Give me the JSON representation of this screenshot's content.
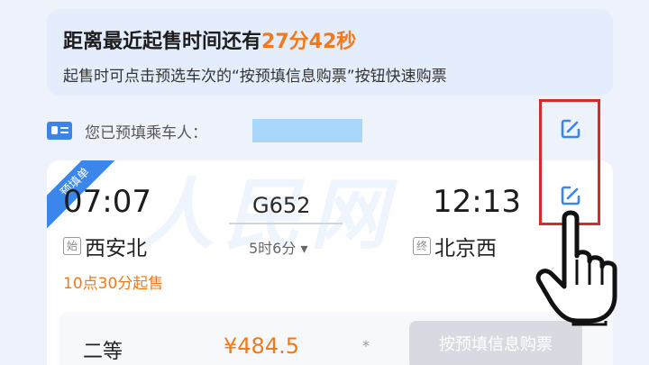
{
  "notice": {
    "line1_prefix": "距离最近起售时间还有",
    "countdown": "27分42秒",
    "line2": "起售时可点击预选车次的“按预填信息购票”按钮快速购票"
  },
  "passenger": {
    "label": "您已预填乘车人："
  },
  "ticket": {
    "tag": "预填单",
    "depart_time": "07:07",
    "arrive_time": "12:13",
    "train_no": "G652",
    "duration": "5时6分 ▾",
    "origin_tag": "始",
    "origin": "西安北",
    "terminal_tag": "终",
    "destination": "北京西",
    "sale_time": "10点30分起售",
    "seat_class": "二等",
    "price": "¥484.5",
    "seat_mark": "*",
    "buy_button": "按预填信息购票"
  },
  "watermark": "人民网",
  "colors": {
    "accent": "#3a86ea",
    "highlight": "#f07a1a",
    "annotation": "#d42a2a"
  },
  "icons": [
    "id-card-icon",
    "edit-icon",
    "pointer-hand-icon"
  ]
}
